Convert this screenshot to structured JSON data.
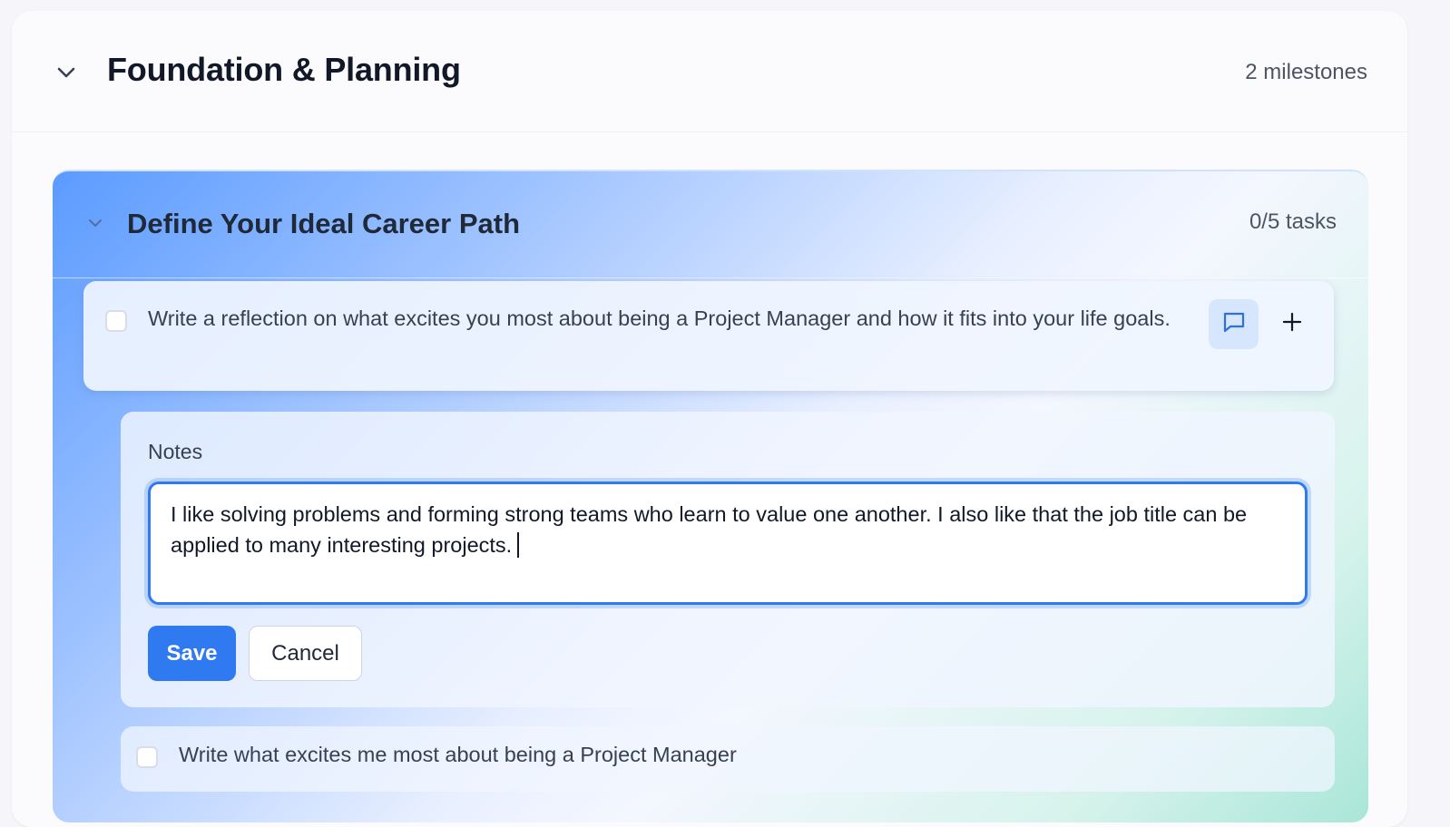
{
  "phase": {
    "title": "Foundation & Planning",
    "milestone_count": "2 milestones"
  },
  "milestone": {
    "title": "Define Your Ideal Career Path",
    "task_count": "0/5 tasks",
    "tasks": [
      {
        "text": "Write a reflection on what excites you most about being a Project Manager and how it fits into your life goals.",
        "checked": false
      },
      {
        "text": "Write what excites me most about being a Project Manager",
        "checked": false
      }
    ]
  },
  "notes": {
    "label": "Notes",
    "value": "I like solving problems and forming strong teams who learn to value one another. I also like that the job title can be applied to many interesting projects.",
    "save_label": "Save",
    "cancel_label": "Cancel"
  },
  "icons": {
    "phase_toggle": "chevron-down-icon",
    "milestone_toggle": "chevron-down-icon",
    "notes": "message-square-icon",
    "add": "plus-icon"
  },
  "colors": {
    "accent": "#2f7af0",
    "notes_button_bg": "#d6e6fd",
    "gradient_start": "#5b9bff",
    "gradient_end": "#a9e6d8"
  }
}
